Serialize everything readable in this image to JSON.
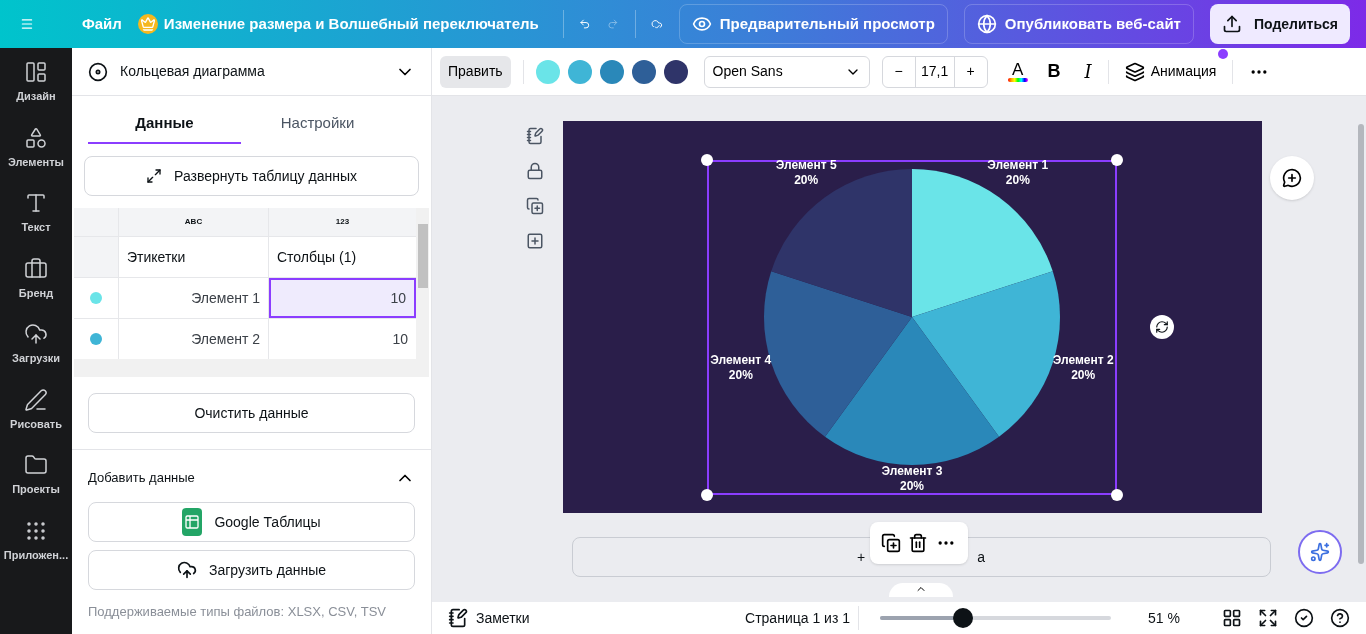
{
  "top_bar": {
    "file_menu": "Файл",
    "title": "Изменение размера и Волшебный переключатель",
    "preview": "Предварительный просмотр",
    "publish": "Опубликовать веб-сайт",
    "share": "Поделиться"
  },
  "rail": [
    {
      "kind": "design",
      "label": "Дизайн"
    },
    {
      "kind": "elements",
      "label": "Элементы"
    },
    {
      "kind": "text",
      "label": "Текст"
    },
    {
      "kind": "brand",
      "label": "Бренд"
    },
    {
      "kind": "uploads",
      "label": "Загрузки"
    },
    {
      "kind": "draw",
      "label": "Рисовать"
    },
    {
      "kind": "projects",
      "label": "Проекты"
    },
    {
      "kind": "apps",
      "label": "Приложен..."
    }
  ],
  "panel": {
    "chart_type": "Кольцевая диаграмма",
    "tabs": [
      {
        "label": "Данные",
        "selected": true
      },
      {
        "label": "Настройки",
        "selected": false
      }
    ],
    "expand_button": "Развернуть таблицу данных",
    "table": {
      "column_types": [
        "ABC",
        "123"
      ],
      "headers": [
        "Этикетки",
        "Столбцы (1)"
      ],
      "rows": [
        {
          "color": "#6ae4e8",
          "label": "Элемент 1",
          "value": "10",
          "selected": true
        },
        {
          "color": "#3fb5d6",
          "label": "Элемент 2",
          "value": "10",
          "selected": false
        }
      ]
    },
    "clear_button": "Очистить данные",
    "add_data": {
      "title": "Добавить данные",
      "expanded": true,
      "buttons": [
        {
          "kind": "sheets",
          "label": "Google Таблицы"
        },
        {
          "kind": "upload",
          "label": "Загрузить данные"
        }
      ],
      "note": "Поддерживаемые типы файлов: XLSX, CSV, TSV"
    }
  },
  "toolbar": {
    "edit": "Править",
    "palette": [
      {
        "color": "#6ae4e8"
      },
      {
        "color": "#3fb5d6"
      },
      {
        "color": "#2a88b9"
      },
      {
        "color": "#2e5f98"
      },
      {
        "color": "#2f3469"
      }
    ],
    "font": "Open Sans",
    "minus": "−",
    "font_size": "17,1",
    "plus": "+",
    "text_color": "A",
    "bold": "B",
    "italic": "I",
    "animation": "Анимация"
  },
  "canvas": {
    "chart_data": {
      "type": "pie",
      "categories": [
        "Элемент 1",
        "Элемент 2",
        "Элемент 3",
        "Элемент 4",
        "Элемент 5"
      ],
      "values": [
        20,
        20,
        20,
        20,
        20
      ],
      "value_labels": [
        "20%",
        "20%",
        "20%",
        "20%",
        "20%"
      ]
    },
    "add_page": [
      "+",
      "а"
    ]
  },
  "bottom_bar": {
    "notes": "Заметки",
    "page": "Страница 1 из 1",
    "zoom": {
      "level": 0.36
    },
    "zoom_reading": "51 %"
  }
}
